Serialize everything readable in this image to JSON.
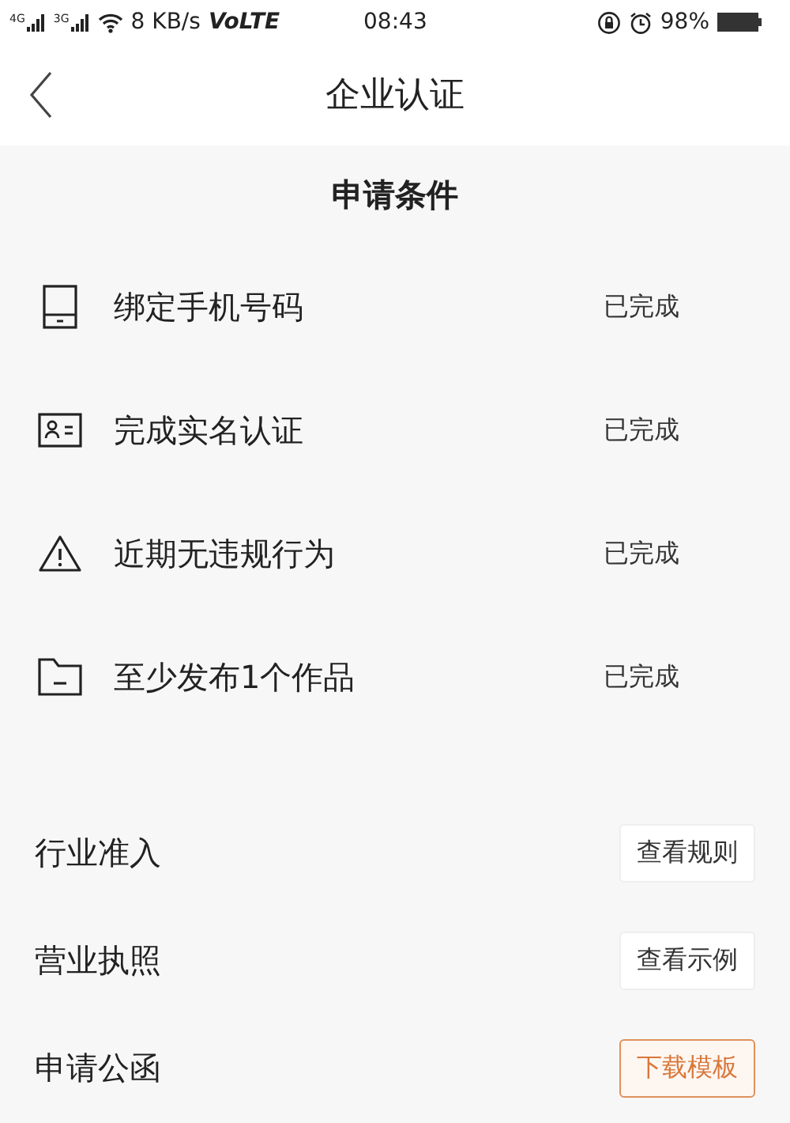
{
  "status_bar": {
    "network_1": "4G",
    "network_2": "3G",
    "speed": "8 KB/s",
    "volte": "VoLTE",
    "time": "08:43",
    "battery": "98%"
  },
  "header": {
    "title": "企业认证"
  },
  "requirements": {
    "title": "申请条件",
    "items": [
      {
        "kind": "phone",
        "label": "绑定手机号码",
        "status": "已完成"
      },
      {
        "kind": "id-card",
        "label": "完成实名认证",
        "status": "已完成"
      },
      {
        "kind": "warning",
        "label": "近期无违规行为",
        "status": "已完成"
      },
      {
        "kind": "folder",
        "label": "至少发布1个作品",
        "status": "已完成"
      }
    ]
  },
  "documents": [
    {
      "label": "行业准入",
      "button": "查看规则",
      "highlighted": false
    },
    {
      "label": "营业执照",
      "button": "查看示例",
      "highlighted": false
    },
    {
      "label": "申请公函",
      "button": "下载模板",
      "highlighted": true
    }
  ]
}
